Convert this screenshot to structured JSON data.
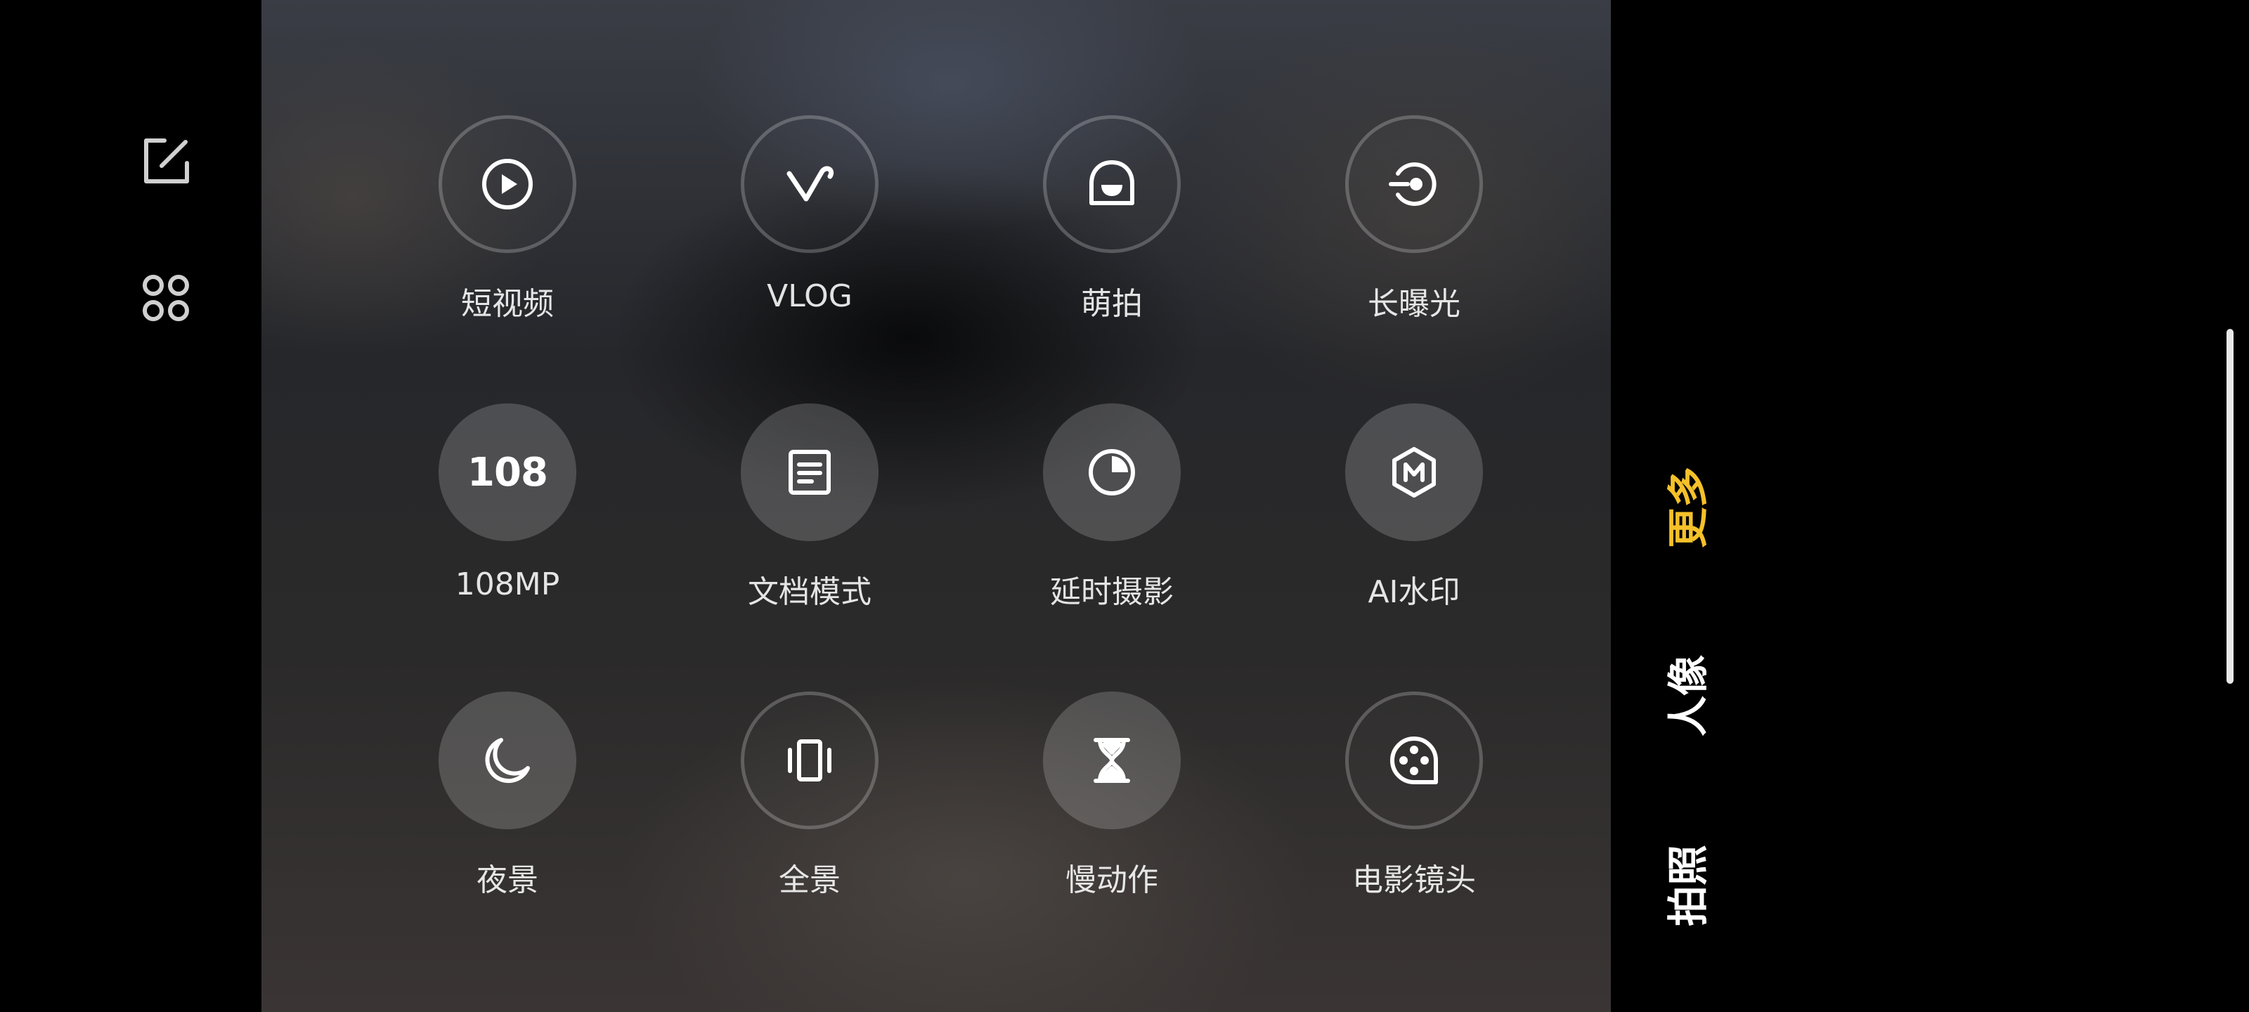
{
  "left_toolbar": {
    "items": [
      {
        "icon": "edit-icon"
      },
      {
        "icon": "grid-icon"
      }
    ]
  },
  "modes": [
    {
      "label": "短视频",
      "icon": "play-icon",
      "style": "outline"
    },
    {
      "label": "VLOG",
      "icon": "vlog-icon",
      "style": "outline"
    },
    {
      "label": "萌拍",
      "icon": "face-icon",
      "style": "outline"
    },
    {
      "label": "长曝光",
      "icon": "long-exposure-icon",
      "style": "outline"
    },
    {
      "label": "108MP",
      "icon": "108-icon",
      "glyph": "108",
      "style": "filled"
    },
    {
      "label": "文档模式",
      "icon": "document-icon",
      "style": "filled"
    },
    {
      "label": "延时摄影",
      "icon": "timelapse-icon",
      "style": "filled"
    },
    {
      "label": "AI水印",
      "icon": "watermark-icon",
      "style": "filled"
    },
    {
      "label": "夜景",
      "icon": "moon-icon",
      "style": "filled"
    },
    {
      "label": "全景",
      "icon": "panorama-icon",
      "style": "outline"
    },
    {
      "label": "慢动作",
      "icon": "hourglass-icon",
      "style": "filled"
    },
    {
      "label": "电影镜头",
      "icon": "film-reel-icon",
      "style": "outline"
    }
  ],
  "mode_tabs": [
    {
      "label": "更多",
      "active": true
    },
    {
      "label": "人像",
      "active": false
    },
    {
      "label": "拍照",
      "active": false
    }
  ],
  "colors": {
    "active_tab": "#f5c12a",
    "background": "#000000"
  }
}
